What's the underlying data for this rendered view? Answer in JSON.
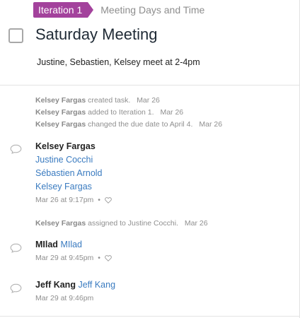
{
  "header": {
    "iteration_label": "Iteration 1",
    "parent_title": "Meeting Days and Time"
  },
  "task": {
    "title": "Saturday Meeting",
    "description": "Justine, Sebastien, Kelsey meet at 2-4pm",
    "completed": false
  },
  "activity": {
    "system_1": {
      "actor": "Kelsey Fargas",
      "text": "created task.",
      "date": "Mar 26"
    },
    "system_2": {
      "actor": "Kelsey Fargas",
      "text": "added to Iteration 1.",
      "date": "Mar 26"
    },
    "system_3": {
      "actor": "Kelsey Fargas",
      "text": "changed the due date to April 4.",
      "date": "Mar 26"
    },
    "comment_1": {
      "author": "Kelsey Fargas",
      "mentions": [
        "Justine Cocchi",
        "Sébastien Arnold",
        "Kelsey Fargas"
      ],
      "timestamp": "Mar 26 at 9:17pm",
      "separator": "•"
    },
    "system_4": {
      "actor": "Kelsey Fargas",
      "text": "assigned to Justine Cocchi.",
      "date": "Mar 26"
    },
    "comment_2": {
      "author": "MIlad",
      "mention": "MIlad",
      "timestamp": "Mar 29 at 9:45pm",
      "separator": "•"
    },
    "comment_3": {
      "author": "Jeff Kang",
      "mention": "Jeff Kang",
      "timestamp": "Mar 29 at 9:46pm"
    }
  },
  "colors": {
    "iteration_tag": "#a3429c",
    "link": "#3a7bc0",
    "muted": "#8f8f8f"
  },
  "icons": {
    "comment": "speech-bubble-icon",
    "like": "heart-icon"
  }
}
